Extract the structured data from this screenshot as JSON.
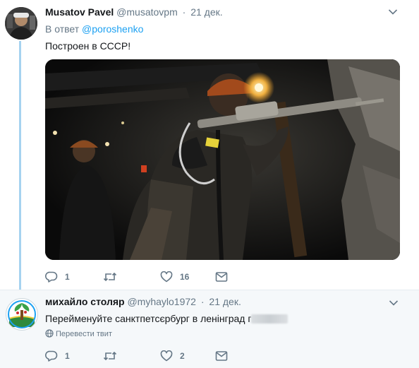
{
  "tweet1": {
    "author_name": "Musatov Pavel",
    "author_handle": "@musatovpm",
    "separator": "·",
    "time": "21 дек.",
    "reply_prefix": "В ответ",
    "reply_mention": "@poroshenko",
    "text": "Построен в СССР!",
    "photo_icon": "photo-miner-with-jackhammer",
    "actions": {
      "reply_count": "1",
      "retweet_count": "",
      "like_count": "16"
    }
  },
  "tweet2": {
    "author_name": "михайло столяр",
    "author_handle": "@myhaylo1972",
    "separator": "·",
    "time": "21 дек.",
    "text": "Перейменуйте санктпетсєрбург в ленінград г",
    "translate_label": "Перевести твит",
    "actions": {
      "reply_count": "1",
      "retweet_count": "",
      "like_count": "2"
    }
  },
  "colors": {
    "accent": "#1da1f2",
    "thread_line": "#a6d3f0",
    "muted": "#657786",
    "reply_bg": "#f5f8fa"
  },
  "icons": [
    "reply-icon",
    "retweet-icon",
    "like-icon",
    "direct-message-icon",
    "caret-down-icon",
    "globe-icon"
  ]
}
